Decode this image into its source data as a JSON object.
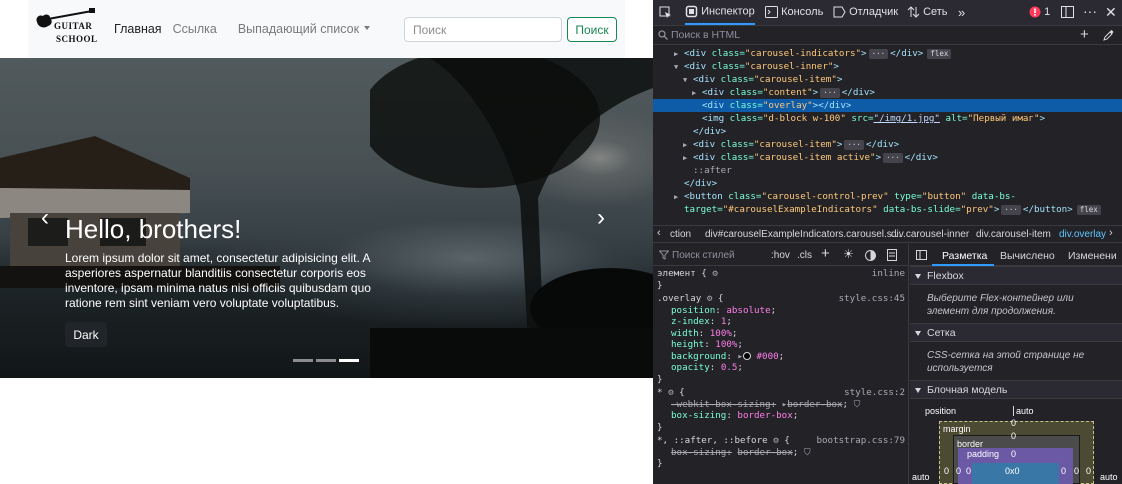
{
  "site": {
    "logo": {
      "line1": "GUITAR",
      "line2": "SCHOOL"
    },
    "nav": {
      "home": "Главная",
      "link": "Ссылка",
      "dropdown": "Выпадающий список"
    },
    "search": {
      "placeholder": "Поиск",
      "button": "Поиск"
    },
    "carousel": {
      "prev_icon": "‹",
      "next_icon": "›",
      "title": "Hello, brothers!",
      "text": "Lorem ipsum dolor sit amet, consectetur adipisicing elit. A asperiores aspernatur blanditiis consectetur corporis eos inventore, ipsam minima natus nisi officiis quibusdam quo ratione rem sint veniam vero voluptate voluptatibus.",
      "button": "Dark",
      "indicators": [
        {
          "active": false
        },
        {
          "active": false
        },
        {
          "active": true
        }
      ]
    },
    "colors": {
      "accent": "#198754",
      "dark_button": "#212529",
      "navbar_bg": "#f8f9fa"
    }
  },
  "devtools": {
    "toolbar": {
      "inspector": "Инспектор",
      "console": "Консоль",
      "debugger": "Отладчик",
      "network": "Сеть",
      "error_count": "1"
    },
    "html_search_placeholder": "Поиск в HTML",
    "code": [
      {
        "indent": 3,
        "arrow": "▶",
        "open": "<div ",
        "attr": "class=",
        "val": "\"carousel-indicators\"",
        "close": ">",
        "dots": true,
        "end": "</div>",
        "badge": "flex"
      },
      {
        "indent": 3,
        "arrow": "▼",
        "open": "<div ",
        "attr": "class=",
        "val": "\"carousel-inner\"",
        "close": ">"
      },
      {
        "indent": 4,
        "arrow": "▼",
        "open": "<div ",
        "attr": "class=",
        "val": "\"carousel-item\"",
        "close": ">"
      },
      {
        "indent": 5,
        "arrow": "▶",
        "open": "<div ",
        "attr": "class=",
        "val": "\"content\"",
        "close": ">",
        "dots": true,
        "end": "</div>"
      },
      {
        "indent": 5,
        "arrow": "",
        "open": "<div ",
        "attr": "class=",
        "val": "\"overlay\"",
        "close": "></div>",
        "hl": true
      },
      {
        "indent": 5,
        "arrow": "",
        "open": "<img ",
        "attr": "class=",
        "val": "\"d-block w-100\"",
        "attr2": " src=",
        "link": "\"/img/1.jpg\"",
        "attr3": " alt=",
        "val3": "\"Первый имаг\"",
        "close": ">"
      },
      {
        "indent": 4,
        "arrow": "",
        "open": "</div>"
      },
      {
        "indent": 4,
        "arrow": "▶",
        "open": "<div ",
        "attr": "class=",
        "val": "\"carousel-item\"",
        "close": ">",
        "dots": true,
        "end": "</div>"
      },
      {
        "indent": 4,
        "arrow": "▶",
        "open": "<div ",
        "attr": "class=",
        "val": "\"carousel-item active\"",
        "close": ">",
        "dots": true,
        "end": "</div>"
      },
      {
        "indent": 4,
        "arrow": "",
        "pseudo": "::after"
      },
      {
        "indent": 3,
        "arrow": "",
        "open": "</div>"
      },
      {
        "indent": 3,
        "arrow": "▶",
        "open": "<button ",
        "attr": "class=",
        "val": "\"carousel-control-prev\"",
        "attr2": " type=",
        "val2": "\"button\"",
        "attr3": " data-bs-",
        "close": ""
      },
      {
        "indent": 3,
        "arrow": "",
        "attr": "target=",
        "val": "\"#carouselExampleIndicators\"",
        "attr2": " data-bs-slide=",
        "val2": "\"prev\"",
        "close": ">",
        "dots": true,
        "end": "</button>",
        "badge": "flex"
      }
    ],
    "breadcrumbs": [
      "ction",
      "div#carouselExampleIndicators.carousel.s…",
      "div.carousel-inner",
      "div.carousel-item",
      "div.overlay"
    ],
    "rules_toolbar": {
      "filter_placeholder": "Поиск стилей",
      "hov": ":hov",
      "cls": ".cls"
    },
    "rules": {
      "element": {
        "selector": "элемент",
        "source": "inline"
      },
      "overlay": {
        "selector": ".overlay",
        "source": "style.css:45",
        "props": [
          {
            "name": "position",
            "value": "absolute"
          },
          {
            "name": "z-index",
            "value": "1"
          },
          {
            "name": "width",
            "value": "100%"
          },
          {
            "name": "height",
            "value": "100%"
          },
          {
            "name": "background",
            "value": "#000"
          },
          {
            "name": "opacity",
            "value": "0.5"
          }
        ]
      },
      "universal": {
        "selector": "*",
        "source": "style.css:2",
        "props": [
          {
            "name": "-webkit-box-sizing",
            "value": "border-box",
            "struck": true
          },
          {
            "name": "box-sizing",
            "value": "border-box"
          }
        ]
      },
      "bootstrap": {
        "selector": "*, ::after, ::before",
        "source": "bootstrap.css:79",
        "props": [
          {
            "name": "box-sizing",
            "value": "border-box",
            "struck": true
          }
        ]
      }
    },
    "layout_tabs": {
      "layout": "Разметка",
      "computed": "Вычислено",
      "changes": "Изменени"
    },
    "flexbox": {
      "title": "Flexbox",
      "hint": "Выберите Flex-контейнер или элемент для продолжения."
    },
    "grid": {
      "title": "Сетка",
      "hint": "CSS-сетка на этой странице не используется"
    },
    "box_model": {
      "title": "Блочная модель",
      "position_label": "position",
      "position_value": "auto",
      "margin_label": "margin",
      "border_label": "border",
      "padding_label": "padding",
      "margin_top": "0",
      "border_top": "0",
      "padding_top": "0",
      "content_size": "0x0",
      "left_auto": "auto",
      "right_auto": "auto",
      "left_values": [
        "0",
        "0",
        "0"
      ],
      "right_values": [
        "0",
        "0",
        "0"
      ]
    }
  }
}
